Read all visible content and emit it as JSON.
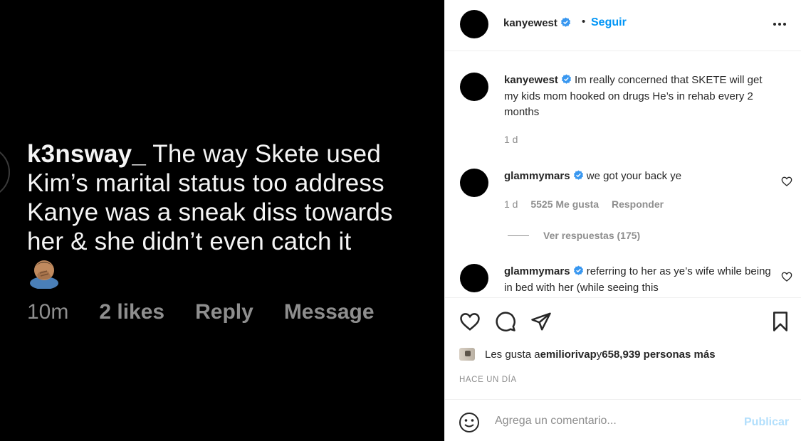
{
  "media": {
    "username": "k3nsway_",
    "comment_text": " The way Skete used Kim’s marital status too address Kanye was a sneak diss towards her & she didn’t even catch it",
    "time": "10m",
    "likes": "2 likes",
    "reply": "Reply",
    "message": "Message"
  },
  "header": {
    "username": "kanyewest",
    "dot": "•",
    "follow": "Seguir"
  },
  "caption": {
    "username": "kanyewest",
    "text": " Im really concerned that SKETE will get my kids mom hooked on drugs He’s in rehab every 2 months",
    "time": "1 d"
  },
  "comments": [
    {
      "username": "glammymars",
      "text": " we got your back ye",
      "time": "1 d",
      "likes": "5525 Me gusta",
      "reply": "Responder",
      "view_replies": "Ver respuestas (175)"
    },
    {
      "username": "glammymars",
      "text": " referring to her as ye’s wife while being in bed with her (while seeing this"
    }
  ],
  "likes_line": {
    "prefix": "Les gusta a ",
    "user": "emiliorivap",
    "middle": " y ",
    "count": "658,939 personas más"
  },
  "post_time": "HACE UN DÍA",
  "add_comment": {
    "placeholder": "Agrega un comentario...",
    "post": "Publicar"
  },
  "colors": {
    "accent": "#0095f6",
    "verified": "#3897f0",
    "muted": "#8e8e8e",
    "post_disabled": "#b2dffc"
  },
  "icons": [
    "verified-badge-icon",
    "more-options-icon",
    "heart-icon",
    "comment-icon",
    "share-icon",
    "bookmark-icon",
    "emoji-icon",
    "facepalm-emoji-icon"
  ]
}
